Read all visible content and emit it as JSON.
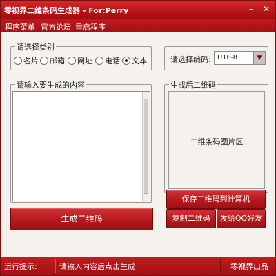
{
  "window": {
    "title": "零视界二维条码生成器 - For:Perry",
    "min": "–",
    "close": "✕"
  },
  "menu": [
    "程序菜单",
    "官方论坛",
    "重启程序"
  ],
  "type_group": {
    "legend": "请选择类别",
    "options": [
      {
        "label": "名片",
        "selected": false
      },
      {
        "label": "邮箱",
        "selected": false
      },
      {
        "label": "网址",
        "selected": false
      },
      {
        "label": "电话",
        "selected": false
      },
      {
        "label": "文本",
        "selected": true
      }
    ]
  },
  "encoding": {
    "label": "请选择编码:",
    "value": "UTF-8",
    "arrow": "▼"
  },
  "input_group": {
    "legend": "请输入要生成的内容",
    "value": ""
  },
  "qr_group": {
    "legend": "生成后二维码",
    "placeholder": "二维条码图片区"
  },
  "buttons": {
    "generate": "生成二维码",
    "save": "保存二维码到计算机",
    "copy": "复制二维码",
    "send_qq": "发给QQ好友"
  },
  "status": {
    "label": "运行提示:",
    "message": "请输入内容后点击生成",
    "brand": "零视界出品"
  },
  "colors": {
    "accent": "#b71416",
    "background": "#f5f2ee"
  }
}
